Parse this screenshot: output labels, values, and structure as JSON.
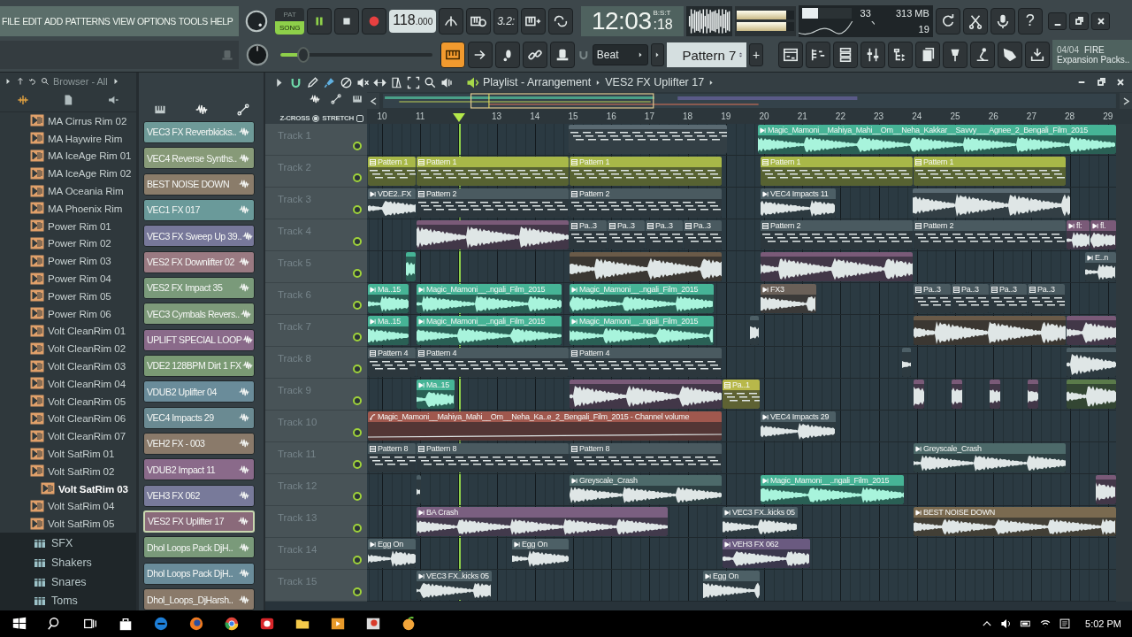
{
  "menu": [
    "FILE",
    "EDIT",
    "ADD",
    "PATTERNS",
    "VIEW",
    "OPTIONS",
    "TOOLS",
    "HELP"
  ],
  "transport": {
    "modes": [
      {
        "label": "PAT",
        "selected": false
      },
      {
        "label": "SONG",
        "selected": true
      }
    ],
    "playing": true,
    "tempo": "118",
    "tempo_fraction": ".000",
    "time": "12:03",
    "time_seconds": ":18",
    "time_units": "B:S:T",
    "step_label": "3.2:"
  },
  "output_meter": [
    {
      "level": 0.86
    },
    {
      "level": 0.86
    }
  ],
  "monitor": {
    "level": 0.33,
    "cpu": "33",
    "memory": "313 MB",
    "polyphony": "19"
  },
  "help_label": "?",
  "master_pitch": {
    "level": 0.15
  },
  "snap": "Beat",
  "pattern": "Pattern 7",
  "add_label": "+",
  "news": {
    "date": "04/04",
    "headline": "FIRE",
    "subtitle": "Expansion Packs.."
  },
  "browser": {
    "title": "Browser - All",
    "items": [
      {
        "label": "MA Cirrus Rim 02",
        "selected": false
      },
      {
        "label": "MA Haywire Rim",
        "selected": false
      },
      {
        "label": "MA IceAge Rim 01",
        "selected": false
      },
      {
        "label": "MA IceAge Rim 02",
        "selected": false
      },
      {
        "label": "MA Oceania Rim",
        "selected": false
      },
      {
        "label": "MA Phoenix Rim",
        "selected": false
      },
      {
        "label": "Power Rim 01",
        "selected": false
      },
      {
        "label": "Power Rim 02",
        "selected": false
      },
      {
        "label": "Power Rim 03",
        "selected": false
      },
      {
        "label": "Power Rim 04",
        "selected": false
      },
      {
        "label": "Power Rim 05",
        "selected": false
      },
      {
        "label": "Power Rim 06",
        "selected": false
      },
      {
        "label": "Volt CleanRim 01",
        "selected": false
      },
      {
        "label": "Volt CleanRim 02",
        "selected": false
      },
      {
        "label": "Volt CleanRim 03",
        "selected": false
      },
      {
        "label": "Volt CleanRim 04",
        "selected": false
      },
      {
        "label": "Volt CleanRim 05",
        "selected": false
      },
      {
        "label": "Volt CleanRim 06",
        "selected": false
      },
      {
        "label": "Volt CleanRim 07",
        "selected": false
      },
      {
        "label": "Volt SatRim 01",
        "selected": false
      },
      {
        "label": "Volt SatRim 02",
        "selected": false
      },
      {
        "label": "Volt SatRim 03",
        "selected": true
      },
      {
        "label": "Volt SatRim 04",
        "selected": false
      },
      {
        "label": "Volt SatRim 05",
        "selected": false
      }
    ],
    "folders": [
      "SFX",
      "Shakers",
      "Snares",
      "Toms"
    ]
  },
  "channels": [
    {
      "name": "VEC3 FX Reverbkicks..",
      "color": "#6e9a98",
      "selected": false
    },
    {
      "name": "VEC4 Reverse Synths..",
      "color": "#879a78",
      "selected": false
    },
    {
      "name": "BEST NOISE DOWN",
      "color": "#8a7c6a",
      "selected": false
    },
    {
      "name": "VEC1 FX 017",
      "color": "#6a9a9a",
      "selected": false
    },
    {
      "name": "VEC3 FX Sweep Up 39..",
      "color": "#77789a",
      "selected": false
    },
    {
      "name": "VES2 FX Downlifter 02",
      "color": "#9a7a82",
      "selected": false
    },
    {
      "name": "VES2 FX Impact 35",
      "color": "#7a9a7a",
      "selected": false
    },
    {
      "name": "VEC3 Cymbals Revers..",
      "color": "#7e9a7a",
      "selected": false
    },
    {
      "name": "UPLIFT SPECIAL LOOP",
      "color": "#8a6a8a",
      "selected": false
    },
    {
      "name": "VDE2 128BPM Dirt 1 FX",
      "color": "#7a9a74",
      "selected": false
    },
    {
      "name": "VDUB2 Uplifter 04",
      "color": "#6a8c9a",
      "selected": false
    },
    {
      "name": "VEC4 Impacts 29",
      "color": "#6a8a92",
      "selected": false
    },
    {
      "name": "VEH2 FX - 003",
      "color": "#8a7a6a",
      "selected": false
    },
    {
      "name": "VDUB2 Impact 11",
      "color": "#8a6a8a",
      "selected": false
    },
    {
      "name": "VEH3 FX 062",
      "color": "#787a9a",
      "selected": false
    },
    {
      "name": "VES2 FX Uplifter 17",
      "color": "#8a6a7a",
      "selected": true
    },
    {
      "name": "Dhol Loops  Pack DjH..",
      "color": "#7a9a7a",
      "selected": false
    },
    {
      "name": "Dhol Loops  Pack DjH..",
      "color": "#6a8c9a",
      "selected": false
    },
    {
      "name": "Dhol_Loops_DjHarsh..",
      "color": "#8a7a6a",
      "selected": false
    }
  ],
  "playlist": {
    "title": "Playlist - Arrangement",
    "pattern": "VES2 FX Uplifter 17",
    "options": [
      {
        "kind": "radio",
        "label": "Z-CROSS",
        "checked": true
      },
      {
        "kind": "checkbox",
        "label": "STRETCH",
        "checked": false
      }
    ],
    "bars": [
      "10",
      "11",
      "13",
      "14",
      "15",
      "16",
      "17",
      "18",
      "19",
      "20",
      "21",
      "22",
      "23",
      "24",
      "25",
      "26",
      "27",
      "28",
      "29"
    ],
    "tracks": [
      {
        "name": "Track 1",
        "enabled": true,
        "clips": [
          {
            "kind": "pattern",
            "color": "#5a6a72"
          },
          {
            "kind": "audio",
            "color": "#46b496",
            "label": "Magic_Mamoni__Mahiya_Mahi__Om__Neha_Kakkar__Savvy___Agnee_2_Bengali_Film_2015"
          }
        ]
      },
      {
        "name": "Track 2",
        "enabled": true,
        "clips": [
          {
            "kind": "pattern",
            "color": "#a8b848",
            "label": "Pattern 1"
          },
          {
            "kind": "pattern",
            "color": "#a8b848",
            "label": "Pattern 1"
          },
          {
            "kind": "pattern",
            "color": "#a8b848",
            "label": "Pattern 1"
          },
          {
            "kind": "pattern",
            "color": "#a8b848",
            "label": "Pattern 1"
          },
          {
            "kind": "pattern",
            "color": "#a8b848",
            "label": "Pattern 1"
          }
        ]
      },
      {
        "name": "Track 3",
        "enabled": true,
        "clips": [
          {
            "kind": "audio",
            "color": "#4d5f66",
            "label": "VDE2..FX"
          },
          {
            "kind": "pattern",
            "color": "#4a5a60",
            "label": "Pattern 2"
          },
          {
            "kind": "pattern",
            "color": "#4a5a60",
            "label": "Pattern 2"
          },
          {
            "kind": "audio",
            "color": "#4d5f66",
            "label": "VEC4 Impacts 11"
          },
          {
            "kind": "audio",
            "color": "#5a6a72"
          }
        ]
      },
      {
        "name": "Track 4",
        "enabled": true,
        "clips": [
          {
            "kind": "audio",
            "color": "#7a5a78"
          },
          {
            "kind": "pattern",
            "color": "#4a5a60",
            "label": "Pa..3"
          },
          {
            "kind": "pattern",
            "color": "#4a5a60",
            "label": "Pa..3"
          },
          {
            "kind": "pattern",
            "color": "#4a5a60",
            "label": "Pa..3"
          },
          {
            "kind": "pattern",
            "color": "#4a5a60",
            "label": "Pa..3"
          },
          {
            "kind": "pattern",
            "color": "#4a5a60",
            "label": "Pattern 2"
          },
          {
            "kind": "pattern",
            "color": "#4a5a60",
            "label": "Pattern 2"
          },
          {
            "kind": "audio",
            "color": "#7a5a78",
            "label": "fl:"
          },
          {
            "kind": "audio",
            "color": "#7a5a78",
            "label": "fl."
          }
        ]
      },
      {
        "name": "Track 5",
        "enabled": true,
        "clips": [
          {
            "kind": "audio",
            "color": "#46b496"
          },
          {
            "kind": "audio",
            "color": "#6a5a48"
          },
          {
            "kind": "audio",
            "color": "#7a5a78"
          },
          {
            "kind": "audio",
            "color": "#4d5f66",
            "label": "E..n"
          }
        ]
      },
      {
        "name": "Track 6",
        "enabled": true,
        "clips": [
          {
            "kind": "audio",
            "color": "#46b496",
            "label": "Ma..15"
          },
          {
            "kind": "audio",
            "color": "#46b496",
            "label": "Magic_Mamoni__..ngali_Film_2015"
          },
          {
            "kind": "audio",
            "color": "#46b496",
            "label": "Magic_Mamoni__..ngali_Film_2015"
          },
          {
            "kind": "audio",
            "color": "#6a6058",
            "label": "FX3"
          },
          {
            "kind": "pattern",
            "color": "#4a5a60",
            "label": "Pa..3"
          },
          {
            "kind": "pattern",
            "color": "#4a5a60",
            "label": "Pa..3"
          },
          {
            "kind": "pattern",
            "color": "#4a5a60",
            "label": "Pa..3"
          },
          {
            "kind": "pattern",
            "color": "#4a5a60",
            "label": "Pa..3"
          }
        ]
      },
      {
        "name": "Track 7",
        "enabled": true,
        "clips": [
          {
            "kind": "audio",
            "color": "#46b496",
            "label": "Ma..15"
          },
          {
            "kind": "audio",
            "color": "#46b496",
            "label": "Magic_Mamoni__..ngali_Film_2015"
          },
          {
            "kind": "audio",
            "color": "#46b496",
            "label": "Magic_Mamoni__..ngali_Film_2015"
          },
          {
            "kind": "audio",
            "color": "#4d5f66"
          },
          {
            "kind": "audio",
            "color": "#6a5a48"
          },
          {
            "kind": "audio",
            "color": "#7a5a78"
          }
        ]
      },
      {
        "name": "Track 8",
        "enabled": true,
        "clips": [
          {
            "kind": "pattern",
            "color": "#4a5a60",
            "label": "Pattern 4"
          },
          {
            "kind": "pattern",
            "color": "#4a5a60",
            "label": "Pattern 4"
          },
          {
            "kind": "pattern",
            "color": "#4a5a60",
            "label": "Pattern 4"
          },
          {
            "kind": "audio",
            "color": "#4d5f66"
          },
          {
            "kind": "audio",
            "color": "#4d5f66"
          }
        ]
      },
      {
        "name": "Track 9",
        "enabled": true,
        "clips": [
          {
            "kind": "audio",
            "color": "#46b496",
            "label": "Ma..15"
          },
          {
            "kind": "audio",
            "color": "#7a5a78"
          },
          {
            "kind": "pattern",
            "color": "#b8b84a",
            "label": "Pa..1"
          },
          {
            "kind": "audio",
            "color": "#7a5a78"
          },
          {
            "kind": "audio",
            "color": "#7a5a78"
          },
          {
            "kind": "audio",
            "color": "#7a5a78"
          },
          {
            "kind": "audio",
            "color": "#7a5a78"
          },
          {
            "kind": "audio",
            "color": "#5a7a4a"
          }
        ]
      },
      {
        "name": "Track 10",
        "enabled": true,
        "clips": [
          {
            "kind": "automation",
            "color": "#a0584e",
            "label": "Magic_Mamoni__Mahiya_Mahi__Om__Neha_Ka..e_2_Bengali_Film_2015 - Channel volume"
          },
          {
            "kind": "audio",
            "color": "#4d5f66",
            "label": "VEC4 Impacts 29"
          }
        ]
      },
      {
        "name": "Track 11",
        "enabled": true,
        "clips": [
          {
            "kind": "pattern",
            "color": "#4a5a60",
            "label": "Pattern 8"
          },
          {
            "kind": "pattern",
            "color": "#4a5a60",
            "label": "Pattern 8"
          },
          {
            "kind": "pattern",
            "color": "#4a5a60",
            "label": "Pattern 8"
          },
          {
            "kind": "audio",
            "color": "#4d6a6a",
            "label": "Greyscale_Crash"
          }
        ]
      },
      {
        "name": "Track 12",
        "enabled": true,
        "clips": [
          {
            "kind": "audio",
            "color": "#4d5f66"
          },
          {
            "kind": "audio",
            "color": "#4d6a6a",
            "label": "Greyscale_Crash"
          },
          {
            "kind": "audio",
            "color": "#46b496",
            "label": "Magic_Mamoni__..ngali_Film_2015"
          },
          {
            "kind": "audio",
            "color": "#7a5a78"
          }
        ]
      },
      {
        "name": "Track 13",
        "enabled": true,
        "clips": [
          {
            "kind": "audio",
            "color": "#7a5f80",
            "label": "BA Crash"
          },
          {
            "kind": "audio",
            "color": "#4d5f66",
            "label": "VEC3 FX..kicks 05"
          },
          {
            "kind": "audio",
            "color": "#7a6a50",
            "label": "BEST NOISE DOWN"
          }
        ]
      },
      {
        "name": "Track 14",
        "enabled": true,
        "clips": [
          {
            "kind": "audio",
            "color": "#4d6066",
            "label": "Egg On"
          },
          {
            "kind": "audio",
            "color": "#4d6066",
            "label": "Egg On"
          },
          {
            "kind": "audio",
            "color": "#6a5a80",
            "label": "VEH3 FX 062"
          }
        ]
      },
      {
        "name": "Track 15",
        "enabled": true,
        "clips": [
          {
            "kind": "audio",
            "color": "#4d5f66",
            "label": "VEC3 FX..kicks 05"
          },
          {
            "kind": "audio",
            "color": "#4d6066",
            "label": "Egg On"
          }
        ]
      }
    ]
  },
  "taskbar": {
    "time": "5:02 PM"
  }
}
